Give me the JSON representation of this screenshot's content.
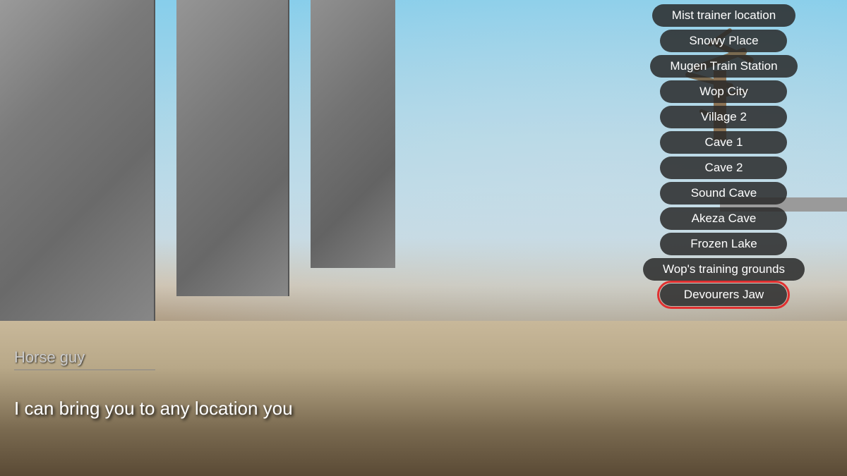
{
  "scene": {
    "npc_name": "Horse guy",
    "npc_dialogue": "I can bring you to any location you"
  },
  "menu": {
    "items": [
      {
        "id": "mist-trainer-location",
        "label": "Mist trainer location",
        "highlighted": false
      },
      {
        "id": "snowy-place",
        "label": "Snowy Place",
        "highlighted": false
      },
      {
        "id": "mugen-train-station",
        "label": "Mugen Train Station",
        "highlighted": false
      },
      {
        "id": "wop-city",
        "label": "Wop City",
        "highlighted": false
      },
      {
        "id": "village-2",
        "label": "Village 2",
        "highlighted": false
      },
      {
        "id": "cave-1",
        "label": "Cave 1",
        "highlighted": false
      },
      {
        "id": "cave-2",
        "label": "Cave 2",
        "highlighted": false
      },
      {
        "id": "sound-cave",
        "label": "Sound Cave",
        "highlighted": false
      },
      {
        "id": "akeza-cave",
        "label": "Akeza Cave",
        "highlighted": false
      },
      {
        "id": "frozen-lake",
        "label": "Frozen Lake",
        "highlighted": false
      },
      {
        "id": "wops-training-grounds",
        "label": "Wop's training grounds",
        "highlighted": false
      },
      {
        "id": "devourers-jaw",
        "label": "Devourers Jaw",
        "highlighted": true
      }
    ]
  }
}
